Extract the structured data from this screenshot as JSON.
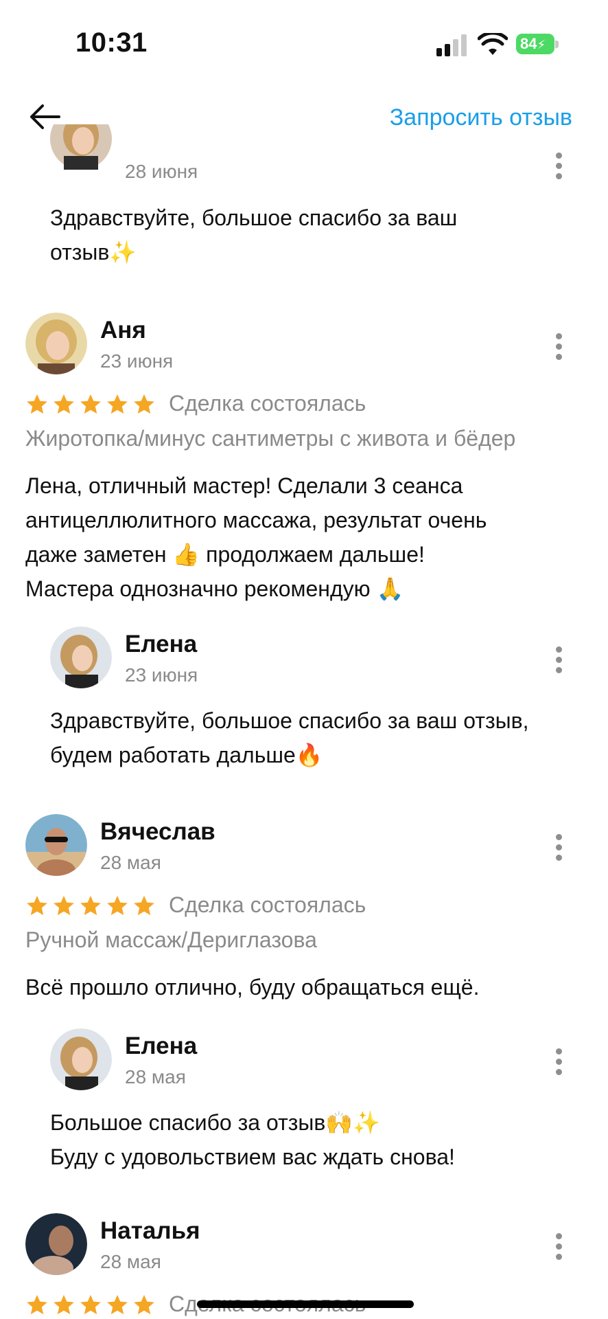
{
  "status_bar": {
    "time": "10:31",
    "battery": "84"
  },
  "header": {
    "request_review": "Запросить отзыв"
  },
  "reviews": [
    {
      "reply": {
        "date": "28 июня",
        "text_lines": [
          "Здравствуйте, большое спасибо за ваш",
          "отзыв✨"
        ]
      }
    },
    {
      "name": "Аня",
      "date": "23 июня",
      "status": "Сделка состоялась",
      "service": "Жиротопка/минус сантиметры с живота и бёдер",
      "text_lines": [
        "Лена, отличный мастер! Сделали 3 сеанса",
        "антицеллюлитного массажа, результат очень",
        "даже заметен 👍 продолжаем дальше!",
        "Мастера однозначно рекомендую 🙏"
      ],
      "reply": {
        "name": "Елена",
        "date": "23 июня",
        "text_lines": [
          "Здравствуйте, большое спасибо за ваш отзыв,",
          "будем работать дальше🔥"
        ]
      }
    },
    {
      "name": "Вячеслав",
      "date": "28 мая",
      "status": "Сделка состоялась",
      "service": "Ручной массаж/Дериглазова",
      "text_lines": [
        "Всё прошло отлично, буду обращаться ещё."
      ],
      "reply": {
        "name": "Елена",
        "date": "28 мая",
        "text_lines": [
          "Большое спасибо за отзыв🙌✨",
          "Буду с удовольствием вас ждать снова!"
        ]
      }
    },
    {
      "name": "Наталья",
      "date": "28 мая",
      "status": "Сделка состоялась"
    }
  ],
  "icons": {
    "back": "arrow-left-icon",
    "menu": "more-vertical-icon",
    "star": "star-icon"
  },
  "colors": {
    "accent": "#1a9ee8",
    "star": "#f5a623",
    "muted": "#8a8a8a",
    "battery": "#4cd964"
  }
}
